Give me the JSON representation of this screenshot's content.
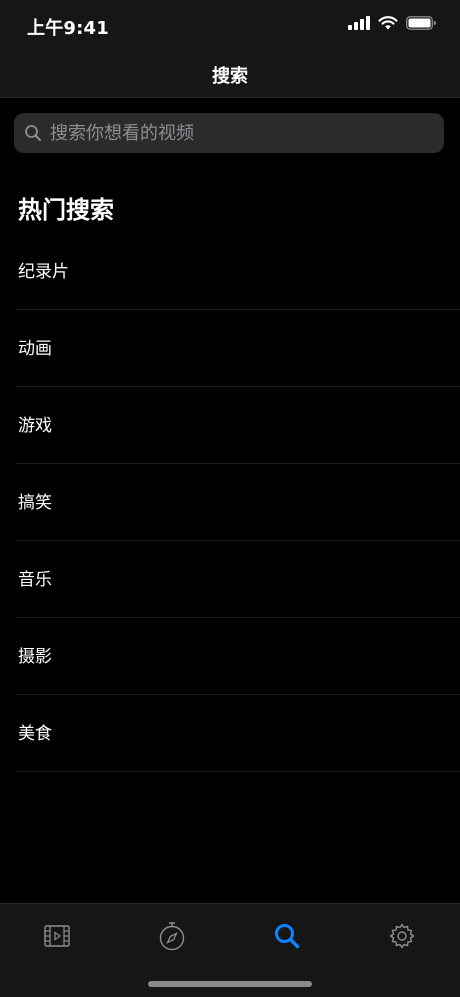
{
  "status_bar": {
    "time": "上午9:41"
  },
  "nav": {
    "title": "搜索"
  },
  "search": {
    "placeholder": "搜索你想看的视频",
    "value": ""
  },
  "section": {
    "title": "热门搜索"
  },
  "hot_searches": [
    {
      "label": "纪录片"
    },
    {
      "label": "动画"
    },
    {
      "label": "游戏"
    },
    {
      "label": "搞笑"
    },
    {
      "label": "音乐"
    },
    {
      "label": "摄影"
    },
    {
      "label": "美食"
    }
  ],
  "tab_bar": {
    "tabs": [
      {
        "icon": "film-icon",
        "active": false
      },
      {
        "icon": "compass-icon",
        "active": false
      },
      {
        "icon": "search-icon",
        "active": true
      },
      {
        "icon": "gear-icon",
        "active": false
      }
    ],
    "active_color": "#0a84ff",
    "inactive_color": "#8e8e93"
  }
}
